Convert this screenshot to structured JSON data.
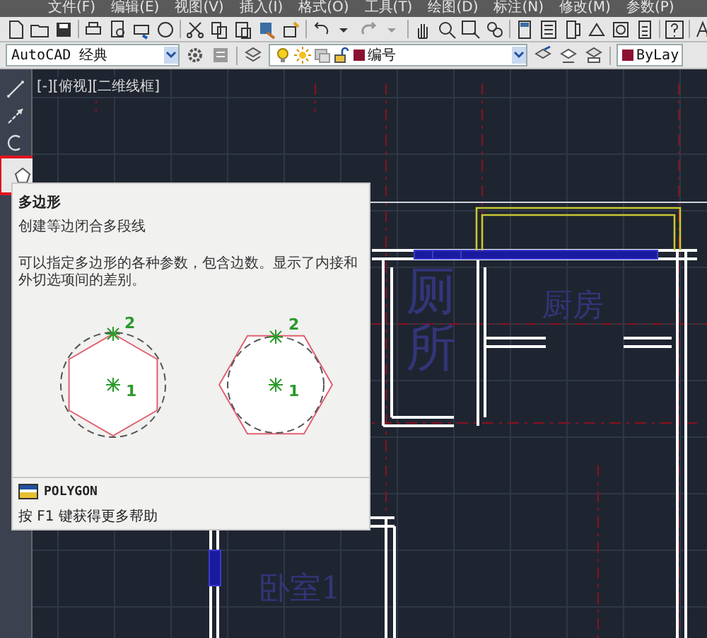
{
  "menu": [
    "文件(F)",
    "编辑(E)",
    "视图(V)",
    "插入(I)",
    "格式(O)",
    "工具(T)",
    "绘图(D)",
    "标注(N)",
    "修改(M)",
    "参数(P)"
  ],
  "workspace": {
    "value": "AutoCAD 经典"
  },
  "layer": {
    "value": "编号",
    "color": "#8b1030"
  },
  "color_control": {
    "value": "ByLay",
    "color": "#8b1030"
  },
  "viewport": {
    "label": "[-][俯视][二维线框]"
  },
  "left_toolbar": [
    {
      "kind": "line",
      "highlighted": false
    },
    {
      "kind": "ray",
      "highlighted": false
    },
    {
      "kind": "arc",
      "highlighted": false
    },
    {
      "kind": "polygon",
      "highlighted": true
    }
  ],
  "tooltip": {
    "title": "多边形",
    "subtitle": "创建等边闭合多段线",
    "description": "可以指定多边形的各种参数，包含边数。显示了内接和外切选项间的差别。",
    "diagram_labels": [
      "2",
      "1",
      "2",
      "1"
    ],
    "command": "POLYGON",
    "help": "按 F1 键获得更多帮助"
  },
  "rooms": [
    {
      "kind": "vertical",
      "label": "厕所"
    },
    {
      "kind": "horizontal",
      "label": "厨房"
    },
    {
      "kind": "horizontal",
      "label": "卧室1"
    }
  ]
}
